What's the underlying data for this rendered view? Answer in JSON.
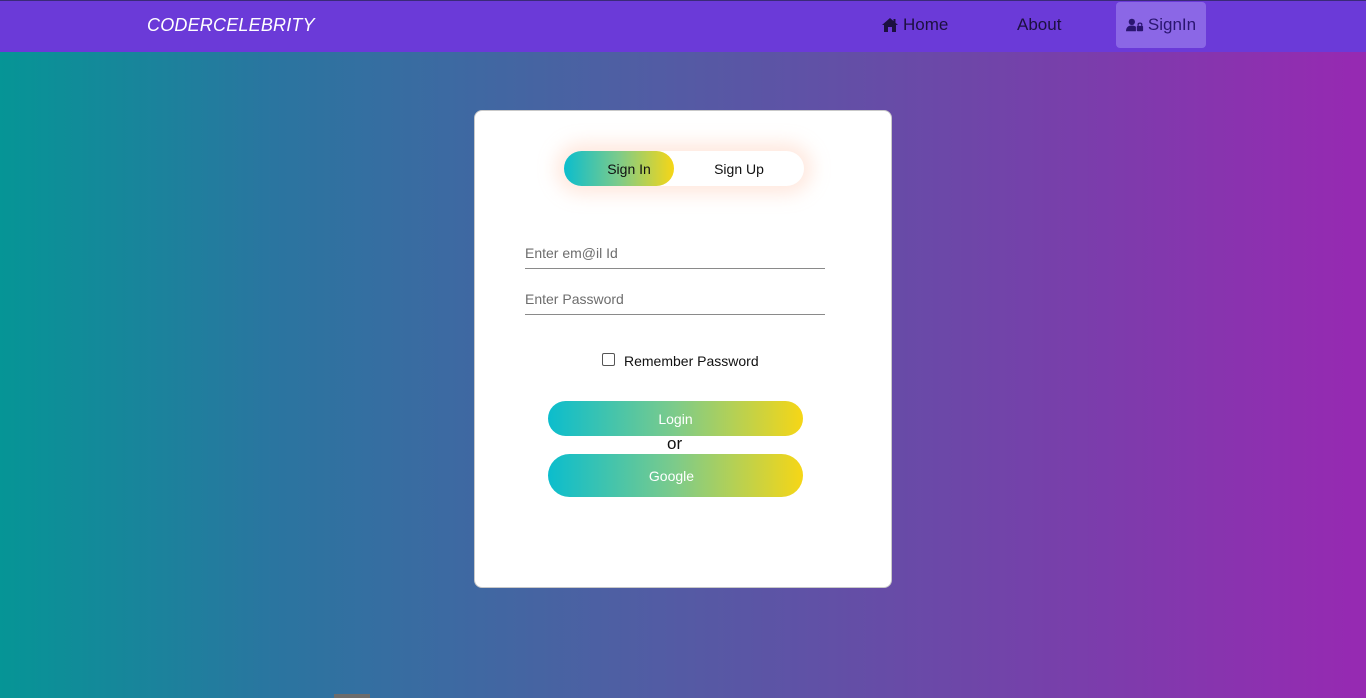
{
  "navbar": {
    "brand": "CODERCELEBRITY",
    "links": [
      {
        "label": "Home",
        "icon": "home-icon"
      },
      {
        "label": "About"
      },
      {
        "label": "SignIn",
        "icon": "user-lock-icon",
        "active": true
      }
    ]
  },
  "form": {
    "tabs": [
      {
        "label": "Sign In",
        "active": true
      },
      {
        "label": "Sign Up",
        "active": false
      }
    ],
    "email": {
      "placeholder": "Enter em@il Id",
      "value": ""
    },
    "password": {
      "placeholder": "Enter Password",
      "value": ""
    },
    "remember": {
      "label": "Remember Password",
      "checked": false
    },
    "login_label": "Login",
    "or_label": "or",
    "google_label": "Google"
  },
  "colors": {
    "navbar": "#6b3ad8",
    "active_nav": "#8b67e6",
    "gradient_start": "#0bbdcd",
    "gradient_end": "#f6d616",
    "bg_left": "#069596",
    "bg_right": "#9729b2"
  }
}
